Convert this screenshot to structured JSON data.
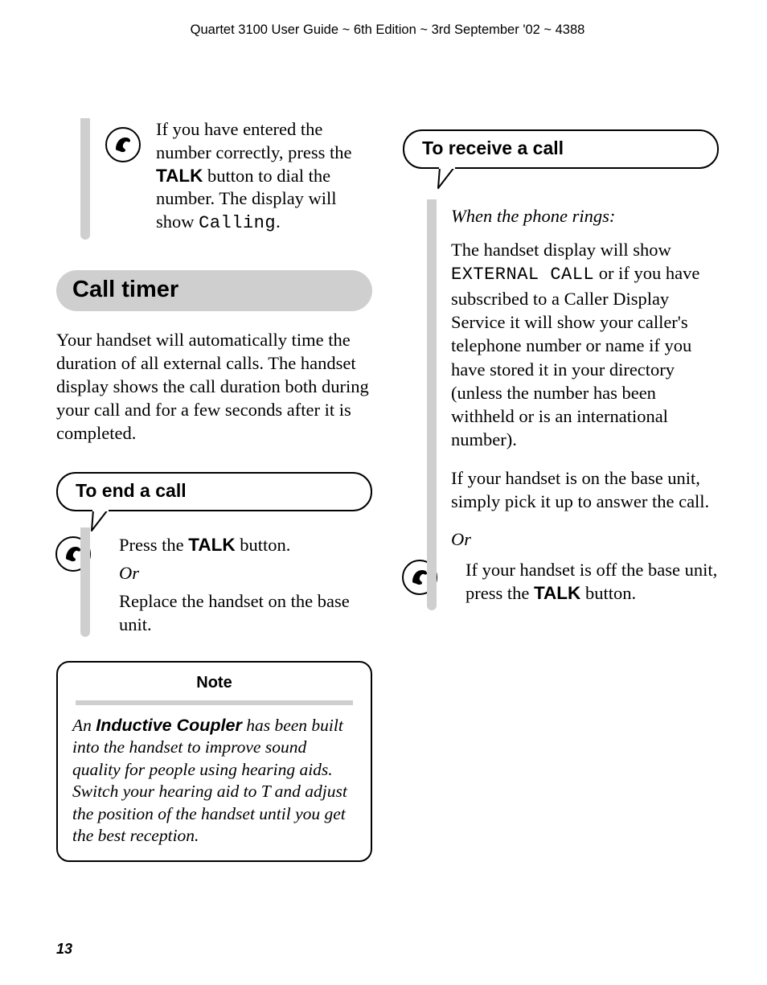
{
  "running_head": "Quartet 3100 User Guide ~ 6th Edition ~ 3rd September '02 ~ 4388",
  "page_number": "13",
  "left": {
    "intro": {
      "pre": "If you have entered the number correctly, press the ",
      "talk": "TALK",
      "mid": " button to dial the number. The display will show ",
      "lcd": "Calling",
      "post": "."
    },
    "section_title": "Call timer",
    "section_body": "Your handset will automatically time the duration of all external calls. The handset display shows the call duration both during your call and for a few seconds after it is completed.",
    "callout_title": "To end a call",
    "end_call": {
      "press_pre": "Press the ",
      "talk": "TALK",
      "press_post": " button.",
      "or": "Or",
      "replace": "Replace the handset on the base unit."
    },
    "note": {
      "title": "Note",
      "pre": "An ",
      "strong": "Inductive Coupler",
      "rest": " has been built into the handset to improve sound quality for people using hearing aids. Switch your hearing aid to T and adjust the position of the handset until you get the best reception."
    }
  },
  "right": {
    "callout_title": "To receive a call",
    "subhead": "When the phone rings:",
    "p1_pre": "The handset display will show ",
    "p1_lcd": "EXTERNAL CALL",
    "p1_post": " or if you have subscribed to a Caller Display Service it will show your caller's telephone number or name if you have stored it in your directory (unless the number has been withheld or is an international number).",
    "p2": "If your handset is on the base unit, simply pick it up to answer the call.",
    "or": "Or",
    "p3_pre": "If your handset is off the base unit, press the ",
    "p3_talk": "TALK",
    "p3_post": " button."
  }
}
